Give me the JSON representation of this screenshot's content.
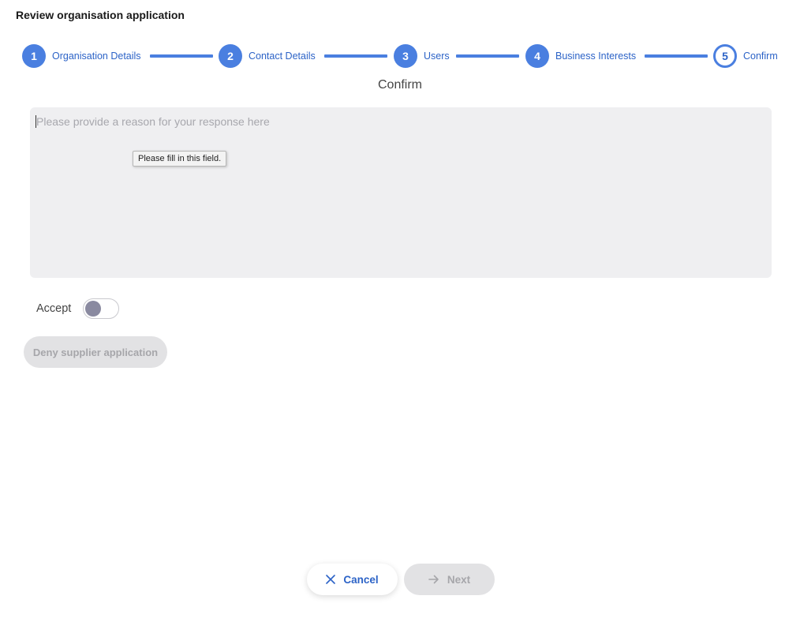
{
  "dialog": {
    "title": "Review organisation application"
  },
  "stepper": {
    "steps": [
      {
        "number": "1",
        "label": "Organisation Details"
      },
      {
        "number": "2",
        "label": "Contact Details"
      },
      {
        "number": "3",
        "label": "Users"
      },
      {
        "number": "4",
        "label": "Business Interests"
      },
      {
        "number": "5",
        "label": "Confirm"
      }
    ],
    "current_step": "5"
  },
  "confirm": {
    "heading": "Confirm",
    "reason": {
      "placeholder": "Please provide a reason for your response here",
      "value": ""
    },
    "validation_message": "Please fill in this field.",
    "accept_label": "Accept",
    "accept_on": false,
    "deny_label": "Deny supplier application"
  },
  "footer": {
    "cancel_label": "Cancel",
    "next_label": "Next"
  },
  "colors": {
    "accent": "#4a7fe0",
    "accent_text": "#2c63c7",
    "disabled_bg": "#e2e2e4",
    "disabled_text": "#a6a6aa",
    "input_bg": "#efeff1"
  }
}
